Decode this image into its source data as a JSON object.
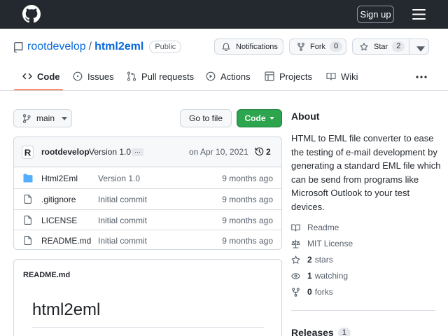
{
  "header": {
    "signup_label": "Sign up"
  },
  "repo": {
    "owner": "rootdevelop",
    "separator": "/",
    "name": "html2eml",
    "visibility": "Public"
  },
  "actions": {
    "notifications_label": "Notifications",
    "fork_label": "Fork",
    "fork_count": "0",
    "star_label": "Star",
    "star_count": "2"
  },
  "tabs": [
    {
      "label": "Code",
      "icon": "code-icon",
      "selected": true
    },
    {
      "label": "Issues",
      "icon": "issue-icon"
    },
    {
      "label": "Pull requests",
      "icon": "pull-request-icon"
    },
    {
      "label": "Actions",
      "icon": "play-icon"
    },
    {
      "label": "Projects",
      "icon": "table-icon"
    },
    {
      "label": "Wiki",
      "icon": "book-icon"
    }
  ],
  "toolbar": {
    "branch": "main",
    "go_to_file": "Go to file",
    "code_button": "Code"
  },
  "latest_commit": {
    "avatar_letter": "R",
    "author": "rootdevelop",
    "message": "Version 1.0",
    "ellipsis": "…",
    "date": "on Apr 10, 2021",
    "commit_count": "2"
  },
  "files": [
    {
      "type": "folder",
      "name": "Html2Eml",
      "message": "Version 1.0",
      "age": "9 months ago"
    },
    {
      "type": "file",
      "name": ".gitignore",
      "message": "Initial commit",
      "age": "9 months ago"
    },
    {
      "type": "file",
      "name": "LICENSE",
      "message": "Initial commit",
      "age": "9 months ago"
    },
    {
      "type": "file",
      "name": "README.md",
      "message": "Initial commit",
      "age": "9 months ago"
    }
  ],
  "readme": {
    "filename": "README.md",
    "heading": "html2eml"
  },
  "about": {
    "title": "About",
    "description": "HTML to EML file converter to ease the testing of e-mail development by generating a standard EML file which can be send from programs like Microsoft Outlook to your test devices.",
    "readme_label": "Readme",
    "license_label": "MIT License",
    "stars_count": "2",
    "stars_label": "stars",
    "watching_count": "1",
    "watching_label": "watching",
    "forks_count": "0",
    "forks_label": "forks"
  },
  "releases": {
    "title": "Releases",
    "count": "1"
  },
  "colors": {
    "header_bg": "#24292f",
    "link": "#0969da",
    "primary_button": "#2da44e",
    "tab_underline": "#fd8c73",
    "folder": "#54aeff"
  }
}
